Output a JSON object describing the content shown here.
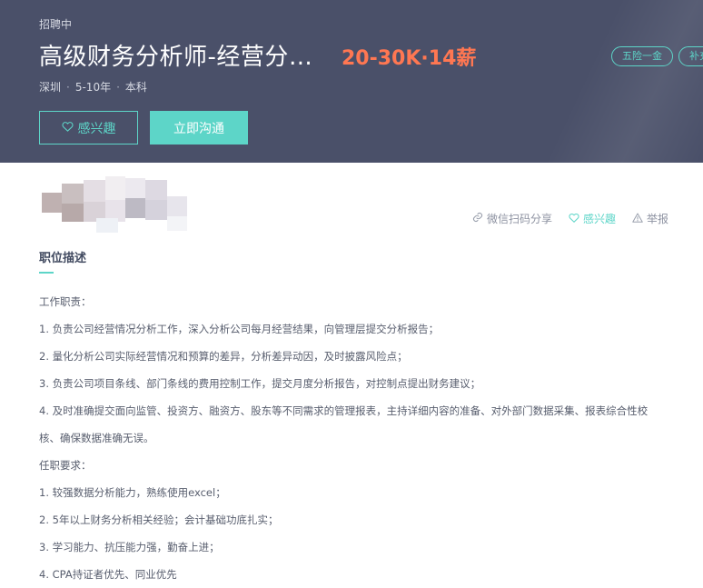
{
  "header": {
    "status": "招聘中",
    "title": "高级财务分析师-经营分…",
    "salary": "20-30K·14薪",
    "meta": {
      "city": "深圳",
      "experience": "5-10年",
      "education": "本科",
      "separator": "·"
    },
    "tags": [
      "五险一金",
      "补充"
    ],
    "interest_label": "感兴趣",
    "chat_label": "立即沟通",
    "colors": {
      "banner": "#4a5069",
      "accent": "#5dd5c8",
      "salary": "#ff7752"
    }
  },
  "actions": {
    "share": {
      "label": "微信扫码分享",
      "icon": "link-icon"
    },
    "interest": {
      "label": "感兴趣",
      "icon": "heart-icon"
    },
    "report": {
      "label": "举报",
      "icon": "warning-icon"
    }
  },
  "description": {
    "title": "职位描述",
    "lines": [
      "工作职责：",
      "1. 负责公司经营情况分析工作，深入分析公司每月经营结果，向管理层提交分析报告；",
      "2. 量化分析公司实际经营情况和预算的差异，分析差异动因，及时披露风险点；",
      "3. 负责公司项目条线、部门条线的费用控制工作，提交月度分析报告，对控制点提出财务建议；",
      "4. 及时准确提交面向监管、投资方、融资方、股东等不同需求的管理报表，主持详细内容的准备、对外部门数据采集、报表综合性校",
      "核、确保数据准确无误。",
      "任职要求：",
      "1. 较强数据分析能力，熟练使用excel；",
      "2. 5年以上财务分析相关经验；会计基础功底扎实；",
      "3. 学习能力、抗压能力强，勤奋上进；",
      "4. CPA持证者优先、同业优先"
    ]
  }
}
